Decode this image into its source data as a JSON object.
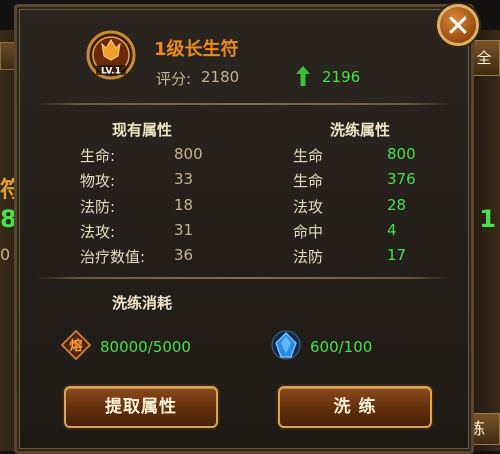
{
  "background": {
    "left_text_1": "符",
    "left_text_2": "8",
    "left_text_3": "0",
    "right_tab": "全",
    "right_text": "1",
    "right_bottom": "练"
  },
  "close_label": "✕",
  "item": {
    "name": "1级长生符",
    "level": "LV.1",
    "score_label": "评分:",
    "score_value": "2180",
    "new_score": "2196"
  },
  "current": {
    "title": "现有属性",
    "attrs": [
      {
        "label": "生命:",
        "value": "800"
      },
      {
        "label": "物攻:",
        "value": "33"
      },
      {
        "label": "法防:",
        "value": "18"
      },
      {
        "label": "法攻:",
        "value": "31"
      },
      {
        "label": "治疗数值:",
        "value": "36"
      }
    ]
  },
  "refine": {
    "title": "洗练属性",
    "attrs": [
      {
        "label": "生命",
        "value": "800"
      },
      {
        "label": "生命",
        "value": "376"
      },
      {
        "label": "法攻",
        "value": "28"
      },
      {
        "label": "命中",
        "value": "4"
      },
      {
        "label": "法防",
        "value": "17"
      }
    ]
  },
  "cost": {
    "title": "洗练消耗",
    "res1_value": "80000/5000",
    "res1_icon_char": "熔",
    "res2_value": "600/100"
  },
  "buttons": {
    "extract": "提取属性",
    "refine": "洗  练"
  },
  "colors": {
    "green": "#49e04c",
    "orange": "#ee8a1c",
    "gold": "#c9b38c"
  }
}
